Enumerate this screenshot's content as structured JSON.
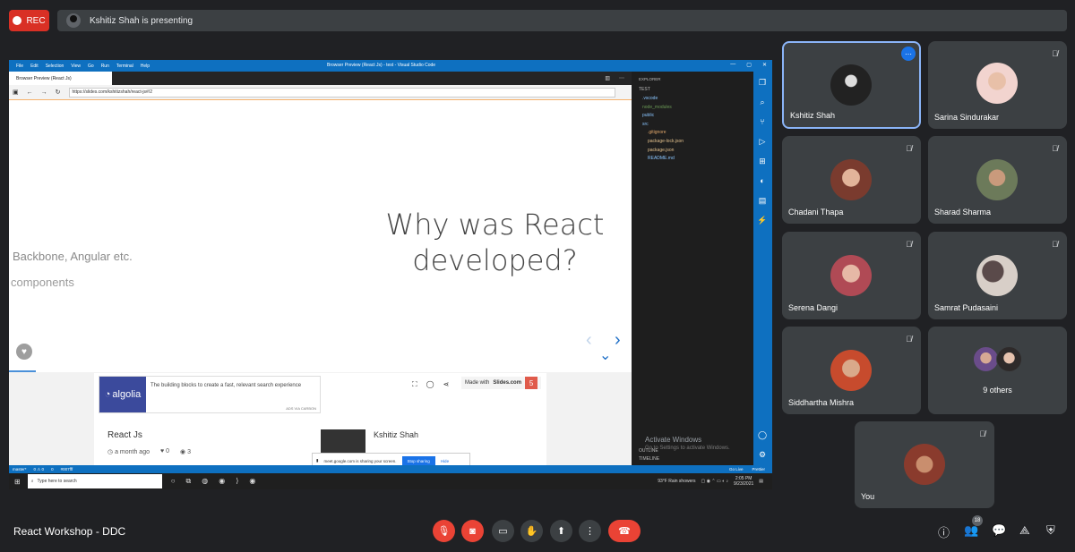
{
  "top_bar": {
    "rec_label": "REC",
    "presenting_text": "Kshitiz Shah is presenting"
  },
  "shared_screen": {
    "vscode": {
      "menu": [
        "File",
        "Edit",
        "Selection",
        "View",
        "Go",
        "Run",
        "Terminal",
        "Help"
      ],
      "window_title": "Browser Preview (React Js) - test - Visual Studio Code",
      "tab_label": "Browser Preview (React Js)",
      "explorer_header": "EXPLORER",
      "explorer_root": "TEST",
      "explorer_items": [
        ".vscode",
        "node_modules",
        "public",
        "src",
        ".gitignore",
        "package-lock.json",
        "package.json",
        "README.md"
      ],
      "outline_label": "OUTLINE",
      "timeline_label": "TIMELINE",
      "status_left": [
        "master*",
        "0 ⚠ 0",
        "0",
        "#007fff"
      ],
      "status_right": [
        "Go Live",
        "Prettier"
      ]
    },
    "browser": {
      "url": "https://slides.com/kshitizshah/react-js#/2"
    },
    "slide": {
      "title_line1": "Why was React",
      "title_line2": "developed?",
      "faded_line1": "Backbone, Angular etc.",
      "faded_line2": "components"
    },
    "slides_page": {
      "ad_brand": "algolia",
      "ad_text": "The building blocks to create a fast, relevant search experience",
      "ad_via": "ADS VIA CARBON",
      "made_with": "Made with",
      "made_with_brand": "Slides.com",
      "slide_count": "5",
      "deck_title": "React Js",
      "deck_age": "a month ago",
      "likes": "0",
      "views": "3",
      "author": "Kshitiz Shah"
    },
    "sharing_bar": {
      "text": "meet.google.com is sharing your screen.",
      "stop_label": "Stop sharing",
      "hide_label": "Hide"
    },
    "watermark": {
      "line1": "Activate Windows",
      "line2": "Go to Settings to activate Windows."
    },
    "taskbar": {
      "search_placeholder": "Type here to search",
      "weather": "93°F  Rain showers",
      "time": "2:05 PM",
      "date": "9/23/2021"
    }
  },
  "participants": [
    {
      "name": "Kshitiz Shah",
      "active": true
    },
    {
      "name": "Sarina Sindurakar"
    },
    {
      "name": "Chadani Thapa"
    },
    {
      "name": "Sharad Sharma"
    },
    {
      "name": "Serena Dangi"
    },
    {
      "name": "Samrat Pudasaini"
    },
    {
      "name": "Siddhartha Mishra"
    },
    {
      "name": "9 others"
    },
    {
      "name": "You"
    }
  ],
  "bottom_bar": {
    "meeting_name": "React Workshop - DDC",
    "people_count": "18"
  },
  "colors": {
    "record_red": "#d93025",
    "active_border": "#8ab4f8",
    "end_call": "#ea4335",
    "vscode_blue": "#0e70c0"
  }
}
